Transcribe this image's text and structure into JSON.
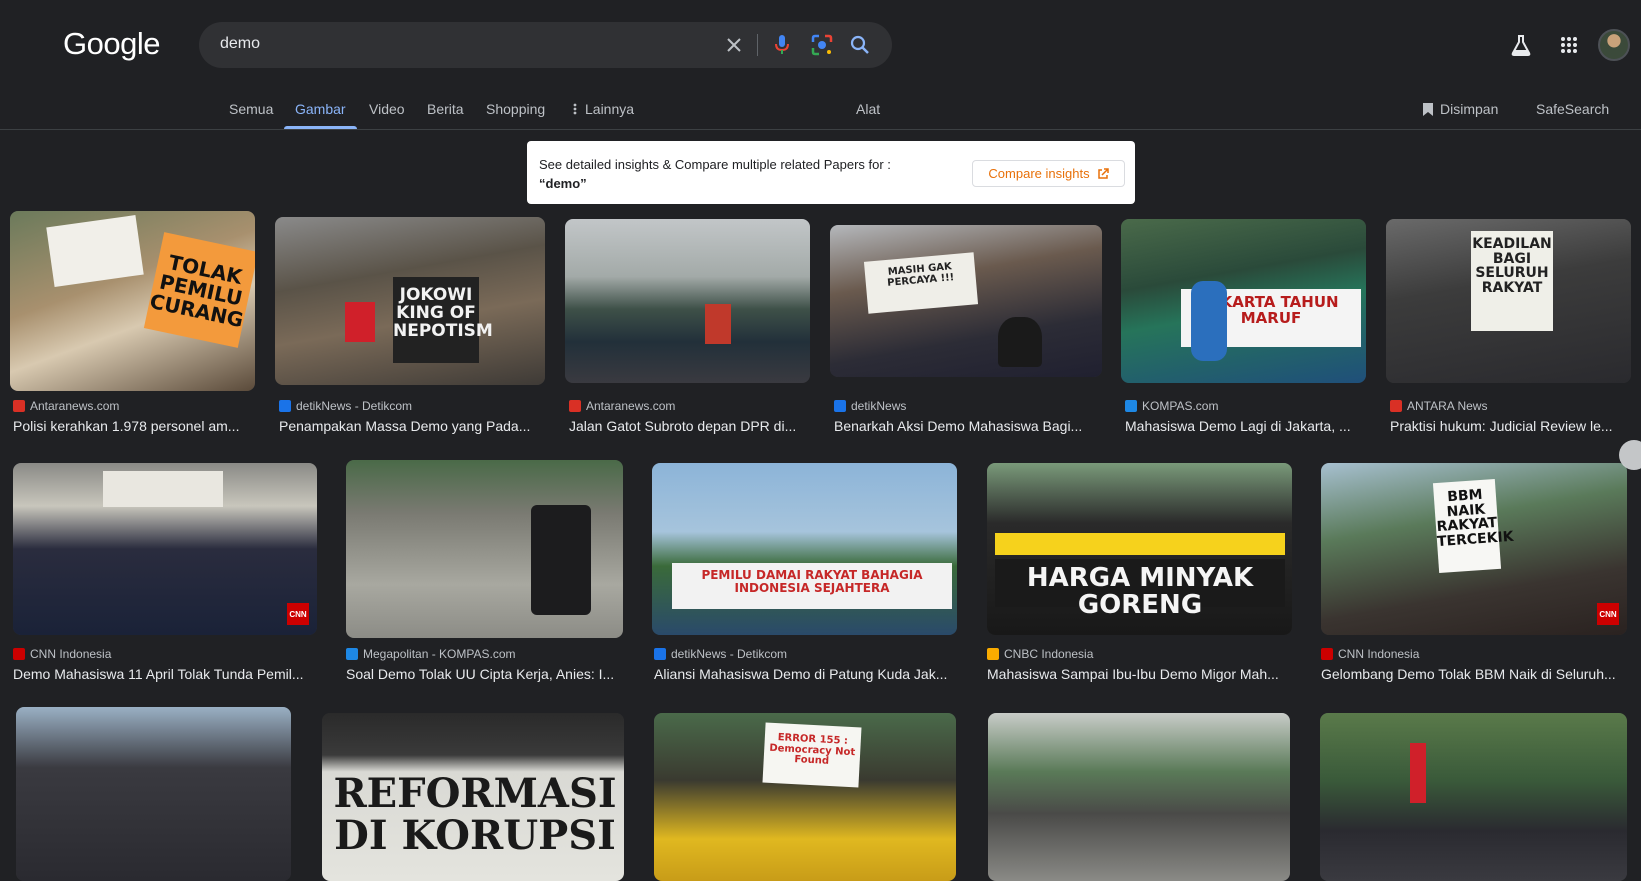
{
  "header": {
    "logo": "Google",
    "search_value": "demo"
  },
  "tabs": [
    {
      "label": "Semua"
    },
    {
      "label": "Gambar"
    },
    {
      "label": "Video"
    },
    {
      "label": "Berita"
    },
    {
      "label": "Shopping"
    },
    {
      "label": "Lainnya"
    },
    {
      "label": "Alat"
    },
    {
      "label": "Disimpan"
    },
    {
      "label": "SafeSearch"
    }
  ],
  "insight": {
    "line1": "See detailed insights & Compare multiple related Papers for :",
    "query": "“demo”",
    "button": "Compare insights"
  },
  "results": [
    {
      "source": "Antaranews.com",
      "title": "Polisi kerahkan 1.978 personel am...",
      "fav_color": "#d93025",
      "img_text": "TOLAK PEMILU CURANG"
    },
    {
      "source": "detikNews - Detikcom",
      "title": "Penampakan Massa Demo yang Pada...",
      "fav_color": "#1a73e8",
      "img_text": "JOKOWI KING OF NEPOTISM"
    },
    {
      "source": "Antaranews.com",
      "title": "Jalan Gatot Subroto depan DPR di...",
      "fav_color": "#d93025",
      "img_text": ""
    },
    {
      "source": "detikNews",
      "title": "Benarkah Aksi Demo Mahasiswa Bagi...",
      "fav_color": "#1a73e8",
      "img_text": "MASIH GAK PERCAYA !!!"
    },
    {
      "source": "KOMPAS.com",
      "title": "Mahasiswa Demo Lagi di Jakarta, ...",
      "fav_color": "#1e88e5",
      "img_text": "JAKARTA TAHUN MARUF"
    },
    {
      "source": "ANTARA News",
      "title": "Praktisi hukum: Judicial Review le...",
      "fav_color": "#d93025",
      "img_text": "KEADILAN BAGI SELURUH RAKYAT"
    },
    {
      "source": "CNN Indonesia",
      "title": "Demo Mahasiswa 11 April Tolak Tunda Pemil...",
      "fav_color": "#cc0000",
      "img_text": ""
    },
    {
      "source": "Megapolitan - KOMPAS.com",
      "title": "Soal Demo Tolak UU Cipta Kerja, Anies: I...",
      "fav_color": "#1e88e5",
      "img_text": ""
    },
    {
      "source": "detikNews - Detikcom",
      "title": "Aliansi Mahasiswa Demo di Patung Kuda Jak...",
      "fav_color": "#1a73e8",
      "img_text": "PEMILU DAMAI RAKYAT BAHAGIA INDONESIA SEJAHTERA"
    },
    {
      "source": "CNBC Indonesia",
      "title": "Mahasiswa Sampai Ibu-Ibu Demo Migor Mah...",
      "fav_color": "#f9ab00",
      "img_text": "HARGA MINYAK GORENG"
    },
    {
      "source": "CNN Indonesia",
      "title": "Gelombang Demo Tolak BBM Naik di Seluruh...",
      "fav_color": "#cc0000",
      "img_text": "BBM NAIK RAKYAT TERCEKIK"
    },
    {
      "source": "",
      "title": "",
      "fav_color": "#5f6368",
      "img_text": ""
    },
    {
      "source": "",
      "title": "",
      "fav_color": "#5f6368",
      "img_text": "REFORMASI DI KORUPSI"
    },
    {
      "source": "",
      "title": "",
      "fav_color": "#5f6368",
      "img_text": "ERROR 155 : Democracy Not Found"
    },
    {
      "source": "",
      "title": "",
      "fav_color": "#5f6368",
      "img_text": ""
    },
    {
      "source": "",
      "title": "",
      "fav_color": "#5f6368",
      "img_text": ""
    }
  ]
}
